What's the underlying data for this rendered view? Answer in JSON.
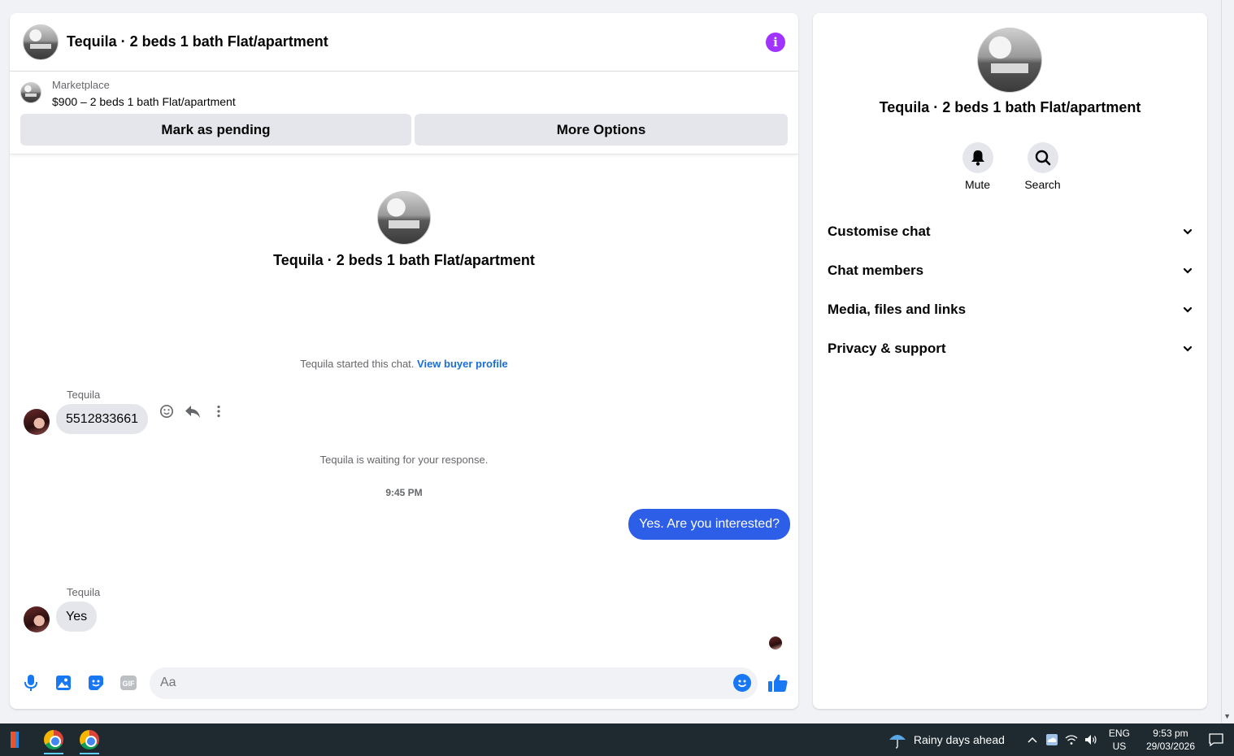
{
  "chat": {
    "title": "Tequila · 2 beds 1 bath Flat/apartment",
    "listing": {
      "source": "Marketplace",
      "price_title": "$900 – 2 beds 1 bath Flat/apartment",
      "mark_pending_label": "Mark as pending",
      "more_options_label": "More Options"
    },
    "conversation_title": "Tequila · 2 beds 1 bath Flat/apartment",
    "started_text": "Tequila started this chat.",
    "view_profile_link": "View buyer profile",
    "messages": [
      {
        "sender": "Tequila",
        "text": "5512833661",
        "direction": "incoming"
      },
      {
        "text": "Yes. Are you interested?",
        "direction": "outgoing"
      },
      {
        "sender": "Tequila",
        "text": "Yes",
        "direction": "incoming"
      }
    ],
    "waiting_text": "Tequila is waiting for your response.",
    "timestamp": "9:45 PM",
    "composer_placeholder": "Aa",
    "accent_color": "#2c5ee8"
  },
  "info_panel": {
    "title": "Tequila · 2 beds 1 bath Flat/apartment",
    "actions": [
      {
        "label": "Mute",
        "icon": "bell-icon"
      },
      {
        "label": "Search",
        "icon": "search-icon"
      }
    ],
    "sections": [
      "Customise chat",
      "Chat members",
      "Media, files and links",
      "Privacy & support"
    ]
  },
  "taskbar": {
    "weather": "Rainy days ahead",
    "lang_top": "ENG",
    "lang_bottom": "US",
    "time": "9:53 pm",
    "date": "29/03/2026"
  }
}
